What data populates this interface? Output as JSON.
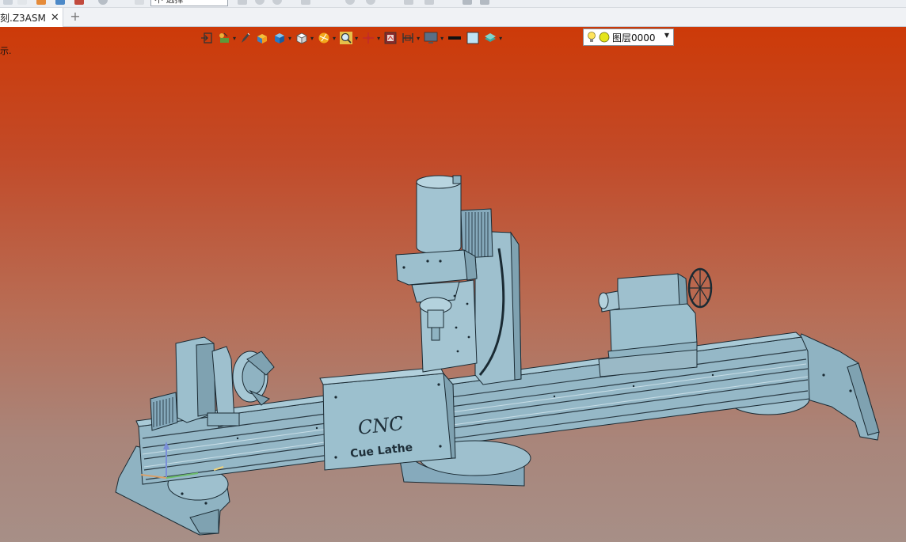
{
  "top_strip": {
    "combo_value": "不 选择"
  },
  "tabs": [
    {
      "label": "刻.Z3ASM",
      "close": "✕"
    }
  ],
  "tab_add": "+",
  "viewport": {
    "hint": "示.",
    "colors": {
      "top": "#cd3a08",
      "bottom": "#a78f87",
      "model_fill": "#8fb3c2",
      "model_edge": "#1a2a33"
    },
    "model": {
      "engraving_title": "CNC",
      "engraving_subtitle": "Cue Lathe"
    }
  },
  "floating_toolbar": {
    "icons": [
      "exit-sketch-icon",
      "filter-icon",
      "pen-icon",
      "shaded-box-icon",
      "blue-cube-icon",
      "white-cube-icon",
      "render-sphere-icon",
      "zoom-icon",
      "crosshair-icon",
      "snapshot-icon",
      "section-view-icon",
      "monitor-icon",
      "line-color-icon",
      "face-color-icon",
      "layer-stack-icon"
    ],
    "layer": {
      "value": "图层0000"
    }
  }
}
